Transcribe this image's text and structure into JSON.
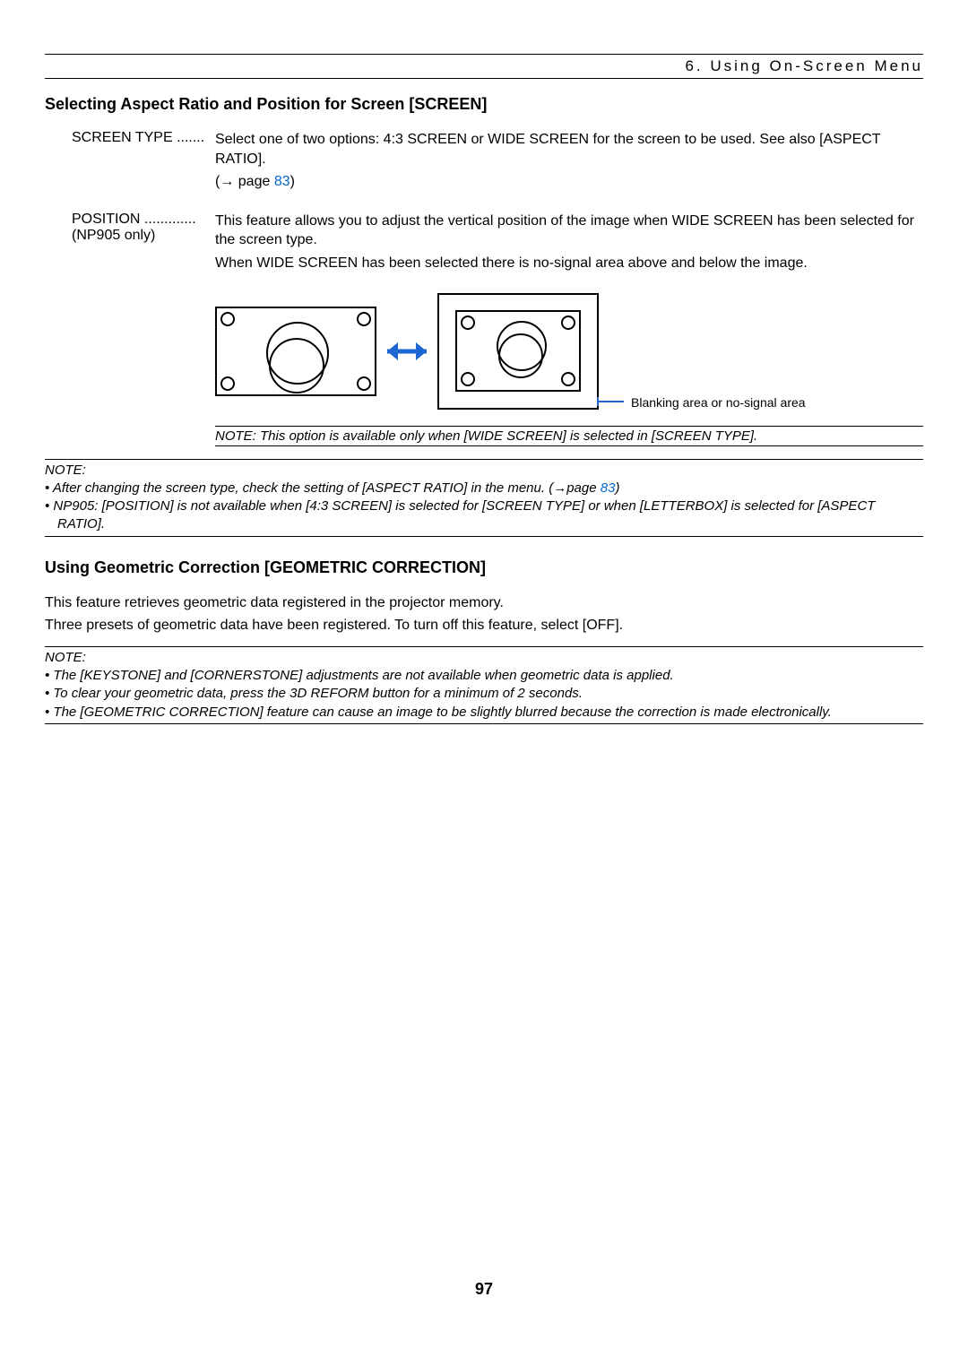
{
  "header": {
    "section": "6. Using On-Screen Menu"
  },
  "h2a": "Selecting Aspect Ratio and Position for Screen [SCREEN]",
  "screenType": {
    "term": "SCREEN TYPE .......",
    "line1": "Select one of two options: 4:3 SCREEN or WIDE SCREEN for the screen to be used. See also [ASPECT RATIO].",
    "refPrefix": "(→ page ",
    "refLink": "83",
    "refSuffix": ")"
  },
  "position": {
    "term": "POSITION .............",
    "sub": "(NP905 only)",
    "line1": "This feature allows you to adjust the vertical position of the image when WIDE SCREEN has been selected for the screen type.",
    "line2": "When WIDE SCREEN has been selected there is no-signal area above and below the image."
  },
  "diagram": {
    "callout": "Blanking area or no-signal area"
  },
  "innerNote": "NOTE: This option is available only when [WIDE SCREEN] is selected in [SCREEN TYPE].",
  "noteA": {
    "label": "NOTE:",
    "b1a": "After changing the screen type, check the setting of [ASPECT RATIO] in the menu. (→page ",
    "b1link": "83",
    "b1b": ")",
    "b2": "NP905: [POSITION] is not available when [4:3 SCREEN] is selected for [SCREEN TYPE] or when [LETTERBOX] is selected for [ASPECT RATIO]."
  },
  "h2b": "Using Geometric Correction [GEOMETRIC CORRECTION]",
  "bodyB1": "This feature retrieves geometric data registered in the projector memory.",
  "bodyB2": "Three presets of geometric data have been registered. To turn off this feature, select [OFF].",
  "noteB": {
    "label": "NOTE:",
    "b1": "The [KEYSTONE] and [CORNERSTONE] adjustments are not available when geometric data is applied.",
    "b2": "To clear your geometric data, press the 3D REFORM button for a minimum of 2 seconds.",
    "b3": "The [GEOMETRIC CORRECTION] feature can cause an image to be slightly blurred because the correction is made electronically."
  },
  "pageNumber": "97"
}
